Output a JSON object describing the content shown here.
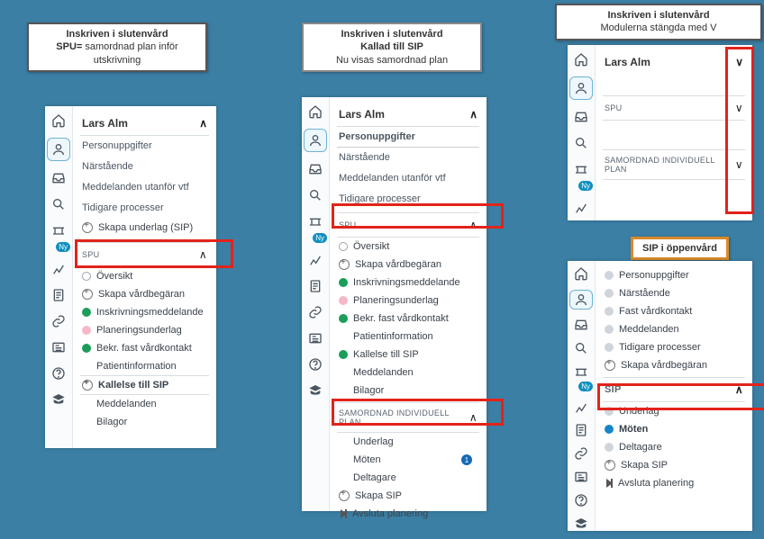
{
  "titles": {
    "t1_l1": "Inskriven i slutenvård",
    "t1_l2a": "SPU=",
    "t1_l2b": " samordnad plan inför",
    "t1_l3": "utskrivning",
    "t2_l1": "Inskriven i slutenvård",
    "t2_l2": "Kallad till SIP",
    "t2_l3": "Nu visas samordnad plan",
    "t3_l1": "Inskriven i slutenvård",
    "t3_l2": "Modulerna stängda med  V",
    "t4": "SIP i öppenvård"
  },
  "patient": {
    "name": "Lars Alm"
  },
  "rail_badge": "Ny",
  "panel1": {
    "items": [
      "Personuppgifter",
      "Närstående",
      "Meddelanden utanför vtf",
      "Tidigare processer"
    ],
    "skapa_underlag": "Skapa underlag (SIP)",
    "spu_hdr": "SPU",
    "spu_rows": [
      {
        "icon": "hollow",
        "t": "Översikt"
      },
      {
        "icon": "plus",
        "t": "Skapa vårdbegäran"
      },
      {
        "icon": "green",
        "t": "Inskrivningsmeddelande"
      },
      {
        "icon": "pink",
        "t": "Planeringsunderlag"
      },
      {
        "icon": "green",
        "t": "Bekr. fast vårdkontakt"
      },
      {
        "icon": "none",
        "t": "Patientinformation"
      },
      {
        "icon": "plus",
        "t": "Kallelse till SIP",
        "hl": true
      },
      {
        "icon": "none",
        "t": "Meddelanden"
      },
      {
        "icon": "none",
        "t": "Bilagor"
      }
    ]
  },
  "panel2": {
    "items": [
      "Personuppgifter",
      "Närstående",
      "Meddelanden utanför vtf",
      "Tidigare processer"
    ],
    "spu_hdr": "SPU",
    "spu_rows": [
      {
        "icon": "hollow",
        "t": "Översikt"
      },
      {
        "icon": "plus",
        "t": "Skapa vårdbegäran"
      },
      {
        "icon": "green",
        "t": "Inskrivningsmeddelande"
      },
      {
        "icon": "pink",
        "t": "Planeringsunderlag"
      },
      {
        "icon": "green",
        "t": "Bekr. fast vårdkontakt"
      },
      {
        "icon": "none",
        "t": "Patientinformation"
      },
      {
        "icon": "green",
        "t": "Kallelse till SIP"
      },
      {
        "icon": "none",
        "t": "Meddelanden"
      },
      {
        "icon": "none",
        "t": "Bilagor"
      }
    ],
    "sip_hdr": "SAMORDNAD INDIVIDUELL PLAN",
    "sip_rows": [
      {
        "icon": "none",
        "t": "Underlag"
      },
      {
        "icon": "none",
        "t": "Möten",
        "badge": "1"
      },
      {
        "icon": "none",
        "t": "Deltagare"
      },
      {
        "icon": "plus",
        "t": "Skapa SIP"
      },
      {
        "icon": "end",
        "t": "Avsluta planering"
      }
    ]
  },
  "panel3": {
    "spu_hdr": "SPU",
    "sip_hdr": "SAMORDNAD INDIVIDUELL PLAN"
  },
  "panel4": {
    "top_rows": [
      {
        "icon": "grey",
        "t": "Personuppgifter"
      },
      {
        "icon": "grey",
        "t": "Närstående"
      },
      {
        "icon": "grey",
        "t": "Fast vårdkontakt"
      },
      {
        "icon": "grey",
        "t": "Meddelanden"
      },
      {
        "icon": "grey",
        "t": "Tidigare processer"
      },
      {
        "icon": "plus",
        "t": "Skapa vårdbegäran"
      }
    ],
    "sip_hdr": "SIP",
    "sip_rows": [
      {
        "icon": "grey",
        "t": "Underlag"
      },
      {
        "icon": "blue",
        "t": "Möten",
        "bold": true
      },
      {
        "icon": "grey",
        "t": "Deltagare"
      },
      {
        "icon": "plus",
        "t": "Skapa SIP"
      },
      {
        "icon": "end",
        "t": "Avsluta planering"
      }
    ]
  }
}
